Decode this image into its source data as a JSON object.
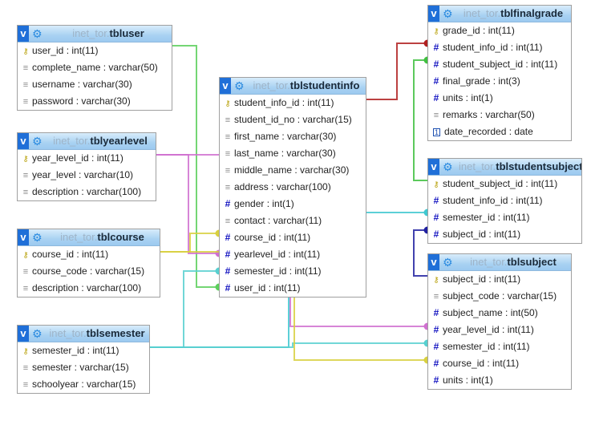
{
  "diagram": {
    "schema": "inet_tor",
    "colors": {
      "header_button": "#1f6fd8",
      "key_icon": "#b8a10a",
      "numeric_icon": "#1010c0",
      "text_icon": "#8a8a8a"
    },
    "tables": [
      {
        "id": "tbluser",
        "schema": "inet_tor.",
        "name": "tbluser",
        "columns": [
          {
            "icon": "key-icon",
            "text": "user_id : int(11)"
          },
          {
            "icon": "text-icon",
            "text": "complete_name : varchar(50)"
          },
          {
            "icon": "text-icon",
            "text": "username : varchar(30)"
          },
          {
            "icon": "text-icon",
            "text": "password : varchar(30)"
          }
        ]
      },
      {
        "id": "tblyearlevel",
        "schema": "inet_tor.",
        "name": "tblyearlevel",
        "columns": [
          {
            "icon": "key-icon",
            "text": "year_level_id : int(11)"
          },
          {
            "icon": "text-icon",
            "text": "year_level : varchar(10)"
          },
          {
            "icon": "text-icon",
            "text": "description : varchar(100)"
          }
        ]
      },
      {
        "id": "tblcourse",
        "schema": "inet_tor.",
        "name": "tblcourse",
        "columns": [
          {
            "icon": "key-icon",
            "text": "course_id : int(11)"
          },
          {
            "icon": "text-icon",
            "text": "course_code : varchar(15)"
          },
          {
            "icon": "text-icon",
            "text": "description : varchar(100)"
          }
        ]
      },
      {
        "id": "tblsemester",
        "schema": "inet_tor.",
        "name": "tblsemester",
        "columns": [
          {
            "icon": "key-icon",
            "text": "semester_id : int(11)"
          },
          {
            "icon": "text-icon",
            "text": "semester : varchar(15)"
          },
          {
            "icon": "text-icon",
            "text": "schoolyear : varchar(15)"
          }
        ]
      },
      {
        "id": "tblstudentinfo",
        "schema": "inet_tor.",
        "name": "tblstudentinfo",
        "columns": [
          {
            "icon": "key-icon",
            "text": "student_info_id : int(11)"
          },
          {
            "icon": "text-icon",
            "text": "student_id_no : varchar(15)"
          },
          {
            "icon": "text-icon",
            "text": "first_name : varchar(30)"
          },
          {
            "icon": "text-icon",
            "text": "last_name : varchar(30)"
          },
          {
            "icon": "text-icon",
            "text": "middle_name : varchar(30)"
          },
          {
            "icon": "text-icon",
            "text": "address : varchar(100)"
          },
          {
            "icon": "numeric-icon",
            "text": "gender : int(1)"
          },
          {
            "icon": "text-icon",
            "text": "contact : varchar(11)"
          },
          {
            "icon": "numeric-icon",
            "text": "course_id : int(11)"
          },
          {
            "icon": "numeric-icon",
            "text": "yearlevel_id : int(11)"
          },
          {
            "icon": "numeric-icon",
            "text": "semester_id : int(11)"
          },
          {
            "icon": "numeric-icon",
            "text": "user_id : int(11)"
          }
        ]
      },
      {
        "id": "tblfinalgrade",
        "schema": "inet_tor.",
        "name": "tblfinalgrade",
        "columns": [
          {
            "icon": "key-icon",
            "text": "grade_id : int(11)"
          },
          {
            "icon": "numeric-icon",
            "text": "student_info_id : int(11)"
          },
          {
            "icon": "numeric-icon",
            "text": "student_subject_id : int(11)"
          },
          {
            "icon": "numeric-icon",
            "text": "final_grade : int(3)"
          },
          {
            "icon": "numeric-icon",
            "text": "units : int(1)"
          },
          {
            "icon": "text-icon",
            "text": "remarks : varchar(50)"
          },
          {
            "icon": "date-icon",
            "text": "date_recorded : date"
          }
        ]
      },
      {
        "id": "tblstudentsubject",
        "schema": "inet_tor.",
        "name": "tblstudentsubject",
        "columns": [
          {
            "icon": "key-icon",
            "text": "student_subject_id : int(11)"
          },
          {
            "icon": "numeric-icon",
            "text": "student_info_id : int(11)"
          },
          {
            "icon": "numeric-icon",
            "text": "semester_id : int(11)"
          },
          {
            "icon": "numeric-icon",
            "text": "subject_id : int(11)"
          }
        ]
      },
      {
        "id": "tblsubject",
        "schema": "inet_tor.",
        "name": "tblsubject",
        "columns": [
          {
            "icon": "key-icon",
            "text": "subject_id : int(11)"
          },
          {
            "icon": "text-icon",
            "text": "subject_code : varchar(15)"
          },
          {
            "icon": "numeric-icon",
            "text": "subject_name : int(50)"
          },
          {
            "icon": "numeric-icon",
            "text": "year_level_id : int(11)"
          },
          {
            "icon": "numeric-icon",
            "text": "semester_id : int(11)"
          },
          {
            "icon": "numeric-icon",
            "text": "course_id : int(11)"
          },
          {
            "icon": "numeric-icon",
            "text": "units : int(1)"
          }
        ]
      }
    ],
    "relations": [
      {
        "from": "tbluser.user_id",
        "to": "tblstudentinfo.user_id",
        "color": "#5ccf5c"
      },
      {
        "from": "tblyearlevel.year_level_id",
        "to": "tblstudentinfo.yearlevel_id",
        "color": "#d070d0"
      },
      {
        "from": "tblcourse.course_id",
        "to": "tblstudentinfo.course_id",
        "color": "#d8d040"
      },
      {
        "from": "tblsemester.semester_id",
        "to": "tblstudentinfo.semester_id",
        "color": "#58d0d0"
      },
      {
        "from": "tblstudentinfo.student_info_id",
        "to": "tblfinalgrade.student_info_id",
        "color": "#b02020"
      },
      {
        "from": "tblstudentsubject.student_subject_id",
        "to": "tblfinalgrade.student_subject_id",
        "color": "#40c040"
      },
      {
        "from": "tblsemester.semester_id",
        "to": "tblstudentsubject.semester_id",
        "color": "#40c8d0"
      },
      {
        "from": "tblsubject.subject_id",
        "to": "tblstudentsubject.subject_id",
        "color": "#2020a0"
      },
      {
        "from": "tblyearlevel.year_level_id",
        "to": "tblsubject.year_level_id",
        "color": "#d070d0"
      },
      {
        "from": "tblsemester.semester_id",
        "to": "tblsubject.semester_id",
        "color": "#58d0d0"
      },
      {
        "from": "tblcourse.course_id",
        "to": "tblsubject.course_id",
        "color": "#d8d040"
      }
    ]
  }
}
